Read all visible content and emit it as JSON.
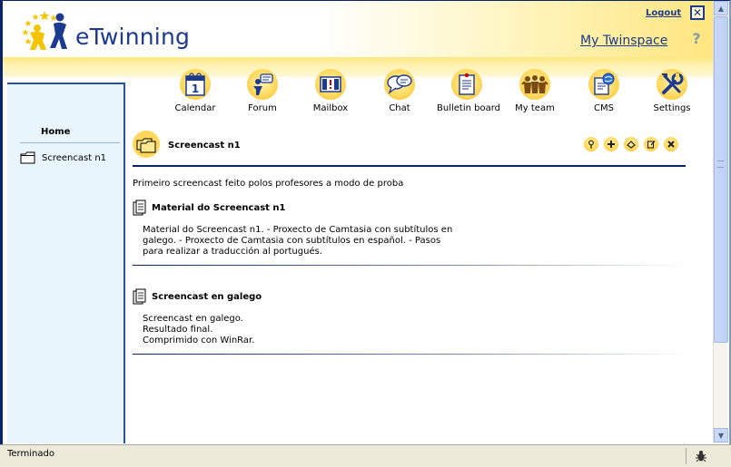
{
  "header": {
    "brand": "eTwinning",
    "logout_label": "Logout",
    "twinspace_label": "My Twinspace",
    "help_icon": "help-icon",
    "close_icon": "close-icon"
  },
  "toolbar": {
    "items": [
      {
        "label": "Calendar",
        "icon": "calendar-icon"
      },
      {
        "label": "Forum",
        "icon": "forum-icon"
      },
      {
        "label": "Mailbox",
        "icon": "mailbox-icon"
      },
      {
        "label": "Chat",
        "icon": "chat-icon"
      },
      {
        "label": "Bulletin board",
        "icon": "bulletin-board-icon"
      },
      {
        "label": "My team",
        "icon": "team-icon"
      },
      {
        "label": "CMS",
        "icon": "cms-icon"
      },
      {
        "label": "Settings",
        "icon": "settings-icon"
      }
    ],
    "calendar_day": "1"
  },
  "sidebar": {
    "home_label": "Home",
    "items": [
      {
        "label": "Screencast n1",
        "icon": "folder-icon"
      }
    ]
  },
  "main": {
    "title": "Screencast n1",
    "description": "Primeiro screencast feito polos profesores a modo de proba",
    "actions": [
      "help-icon",
      "add-icon",
      "edit-icon",
      "properties-icon",
      "delete-icon"
    ],
    "sections": [
      {
        "title": "Material do Screencast n1",
        "lines": [
          "Material do Screencast n1. - Proxecto de Camtasia con subtítulos en",
          "galego. - Proxecto de Camtasia con subtítulos en español. - Pasos",
          "para realizar a traducción al portugués."
        ]
      },
      {
        "title": "Screencast en galego",
        "lines": [
          "Screencast en galego.",
          "Resultado final.",
          "Comprimido con WinRar."
        ]
      }
    ]
  },
  "status": {
    "text": "Terminado"
  },
  "colors": {
    "brand_blue": "#1c3a8f",
    "accent_yellow": "#ffd75a",
    "sidebar_bg": "#e8f5fc"
  }
}
